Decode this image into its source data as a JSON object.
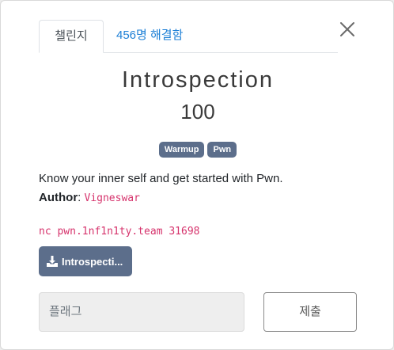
{
  "tabs": {
    "challenge_label": "챌린지",
    "solves_label": "456명 해결함"
  },
  "challenge": {
    "name": "Introspection",
    "points": "100",
    "tags": [
      "Warmup",
      "Pwn"
    ],
    "description": "Know your inner self and get started with Pwn.",
    "author_label": "Author",
    "author_sep": ":",
    "author_name": "Vigneswar",
    "connection": "nc pwn.1nf1n1ty.team 31698"
  },
  "download": {
    "label": "Introspecti...",
    "icon": "download-icon"
  },
  "flag": {
    "placeholder": "플래그",
    "submit_label": "제출"
  },
  "colors": {
    "accent": "#1c7fd6",
    "tag_bg": "#5c6e8b",
    "code": "#d6336c"
  }
}
